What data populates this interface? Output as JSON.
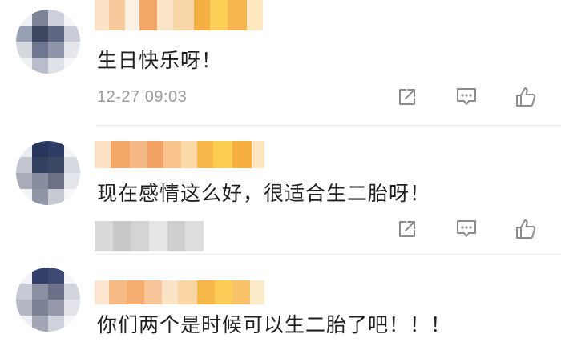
{
  "comments": [
    {
      "text": "生日快乐呀！",
      "time": "12-27 09:03",
      "time_obscured": false
    },
    {
      "text": "现在感情这么好，很适合生二胎呀！",
      "time": "",
      "time_obscured": true
    },
    {
      "text": "你们两个是时候可以生二胎了吧！！！",
      "time": "",
      "time_obscured": false
    }
  ],
  "icons": {
    "share": "share-icon",
    "reply": "comment-icon",
    "like": "thumbs-up-icon"
  },
  "colors": {
    "text": "#1f1f1f",
    "meta": "#9a9a9a",
    "icon": "#8c8c8c",
    "divider": "#ececec",
    "username_blur": [
      "#f3a15a",
      "#f7c98a",
      "#fde2b8",
      "#f5b043",
      "#fbd45a"
    ]
  }
}
